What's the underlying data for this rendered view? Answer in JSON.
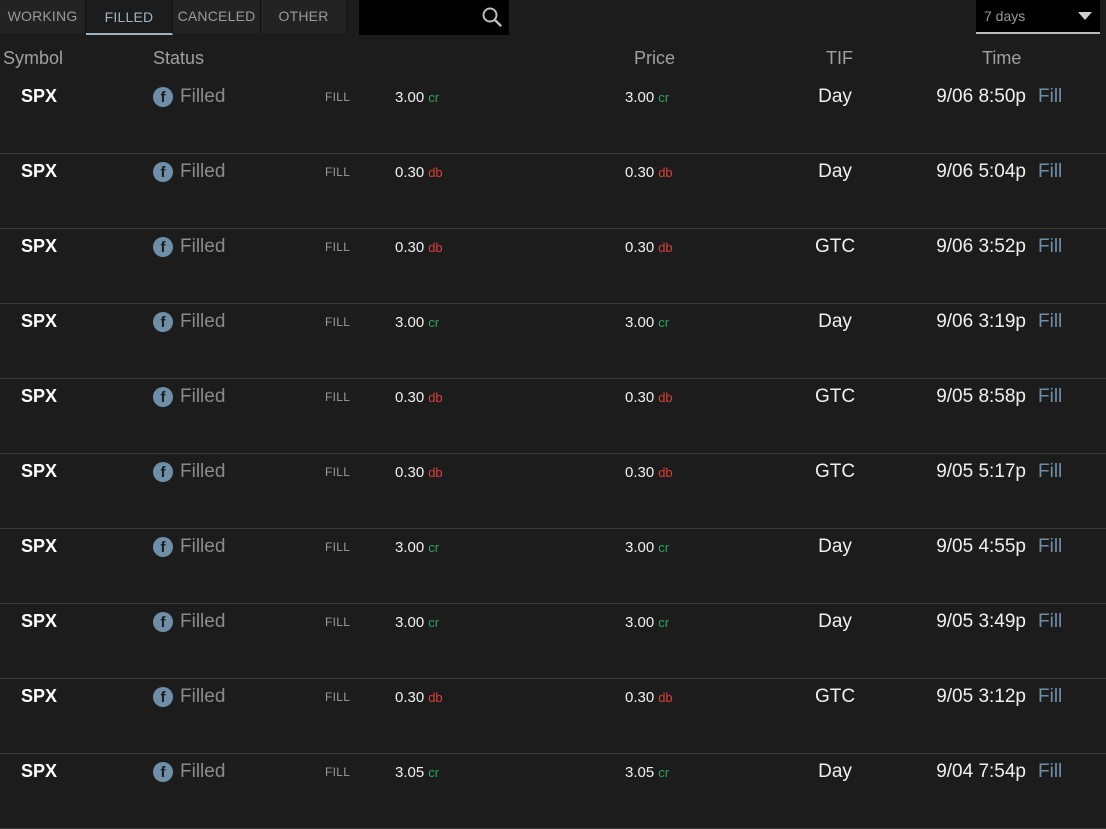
{
  "tabs": [
    {
      "label": "WORKING",
      "active": false
    },
    {
      "label": "FILLED",
      "active": true
    },
    {
      "label": "CANCELED",
      "active": false
    },
    {
      "label": "OTHER",
      "active": false
    }
  ],
  "search": {
    "value": "",
    "icon": "search-icon"
  },
  "period_select": {
    "value": "7 days"
  },
  "columns": {
    "symbol": "Symbol",
    "status": "Status",
    "price": "Price",
    "tif": "TIF",
    "time": "Time"
  },
  "colors": {
    "credit": "#2fa35a",
    "debit": "#d9403a",
    "accent": "#6f8fa8"
  },
  "orders": [
    {
      "symbol": "SPX",
      "status_icon": "f",
      "status": "Filled",
      "type": "FILL",
      "amount": "3.00",
      "amount_suffix": "cr",
      "price": "3.00",
      "price_suffix": "cr",
      "tif": "Day",
      "time": "9/06 8:50p",
      "action": "Fill"
    },
    {
      "symbol": "SPX",
      "status_icon": "f",
      "status": "Filled",
      "type": "FILL",
      "amount": "0.30",
      "amount_suffix": "db",
      "price": "0.30",
      "price_suffix": "db",
      "tif": "Day",
      "time": "9/06 5:04p",
      "action": "Fill"
    },
    {
      "symbol": "SPX",
      "status_icon": "f",
      "status": "Filled",
      "type": "FILL",
      "amount": "0.30",
      "amount_suffix": "db",
      "price": "0.30",
      "price_suffix": "db",
      "tif": "GTC",
      "time": "9/06 3:52p",
      "action": "Fill"
    },
    {
      "symbol": "SPX",
      "status_icon": "f",
      "status": "Filled",
      "type": "FILL",
      "amount": "3.00",
      "amount_suffix": "cr",
      "price": "3.00",
      "price_suffix": "cr",
      "tif": "Day",
      "time": "9/06 3:19p",
      "action": "Fill"
    },
    {
      "symbol": "SPX",
      "status_icon": "f",
      "status": "Filled",
      "type": "FILL",
      "amount": "0.30",
      "amount_suffix": "db",
      "price": "0.30",
      "price_suffix": "db",
      "tif": "GTC",
      "time": "9/05 8:58p",
      "action": "Fill"
    },
    {
      "symbol": "SPX",
      "status_icon": "f",
      "status": "Filled",
      "type": "FILL",
      "amount": "0.30",
      "amount_suffix": "db",
      "price": "0.30",
      "price_suffix": "db",
      "tif": "GTC",
      "time": "9/05 5:17p",
      "action": "Fill"
    },
    {
      "symbol": "SPX",
      "status_icon": "f",
      "status": "Filled",
      "type": "FILL",
      "amount": "3.00",
      "amount_suffix": "cr",
      "price": "3.00",
      "price_suffix": "cr",
      "tif": "Day",
      "time": "9/05 4:55p",
      "action": "Fill"
    },
    {
      "symbol": "SPX",
      "status_icon": "f",
      "status": "Filled",
      "type": "FILL",
      "amount": "3.00",
      "amount_suffix": "cr",
      "price": "3.00",
      "price_suffix": "cr",
      "tif": "Day",
      "time": "9/05 3:49p",
      "action": "Fill"
    },
    {
      "symbol": "SPX",
      "status_icon": "f",
      "status": "Filled",
      "type": "FILL",
      "amount": "0.30",
      "amount_suffix": "db",
      "price": "0.30",
      "price_suffix": "db",
      "tif": "GTC",
      "time": "9/05 3:12p",
      "action": "Fill"
    },
    {
      "symbol": "SPX",
      "status_icon": "f",
      "status": "Filled",
      "type": "FILL",
      "amount": "3.05",
      "amount_suffix": "cr",
      "price": "3.05",
      "price_suffix": "cr",
      "tif": "Day",
      "time": "9/04 7:54p",
      "action": "Fill"
    }
  ]
}
